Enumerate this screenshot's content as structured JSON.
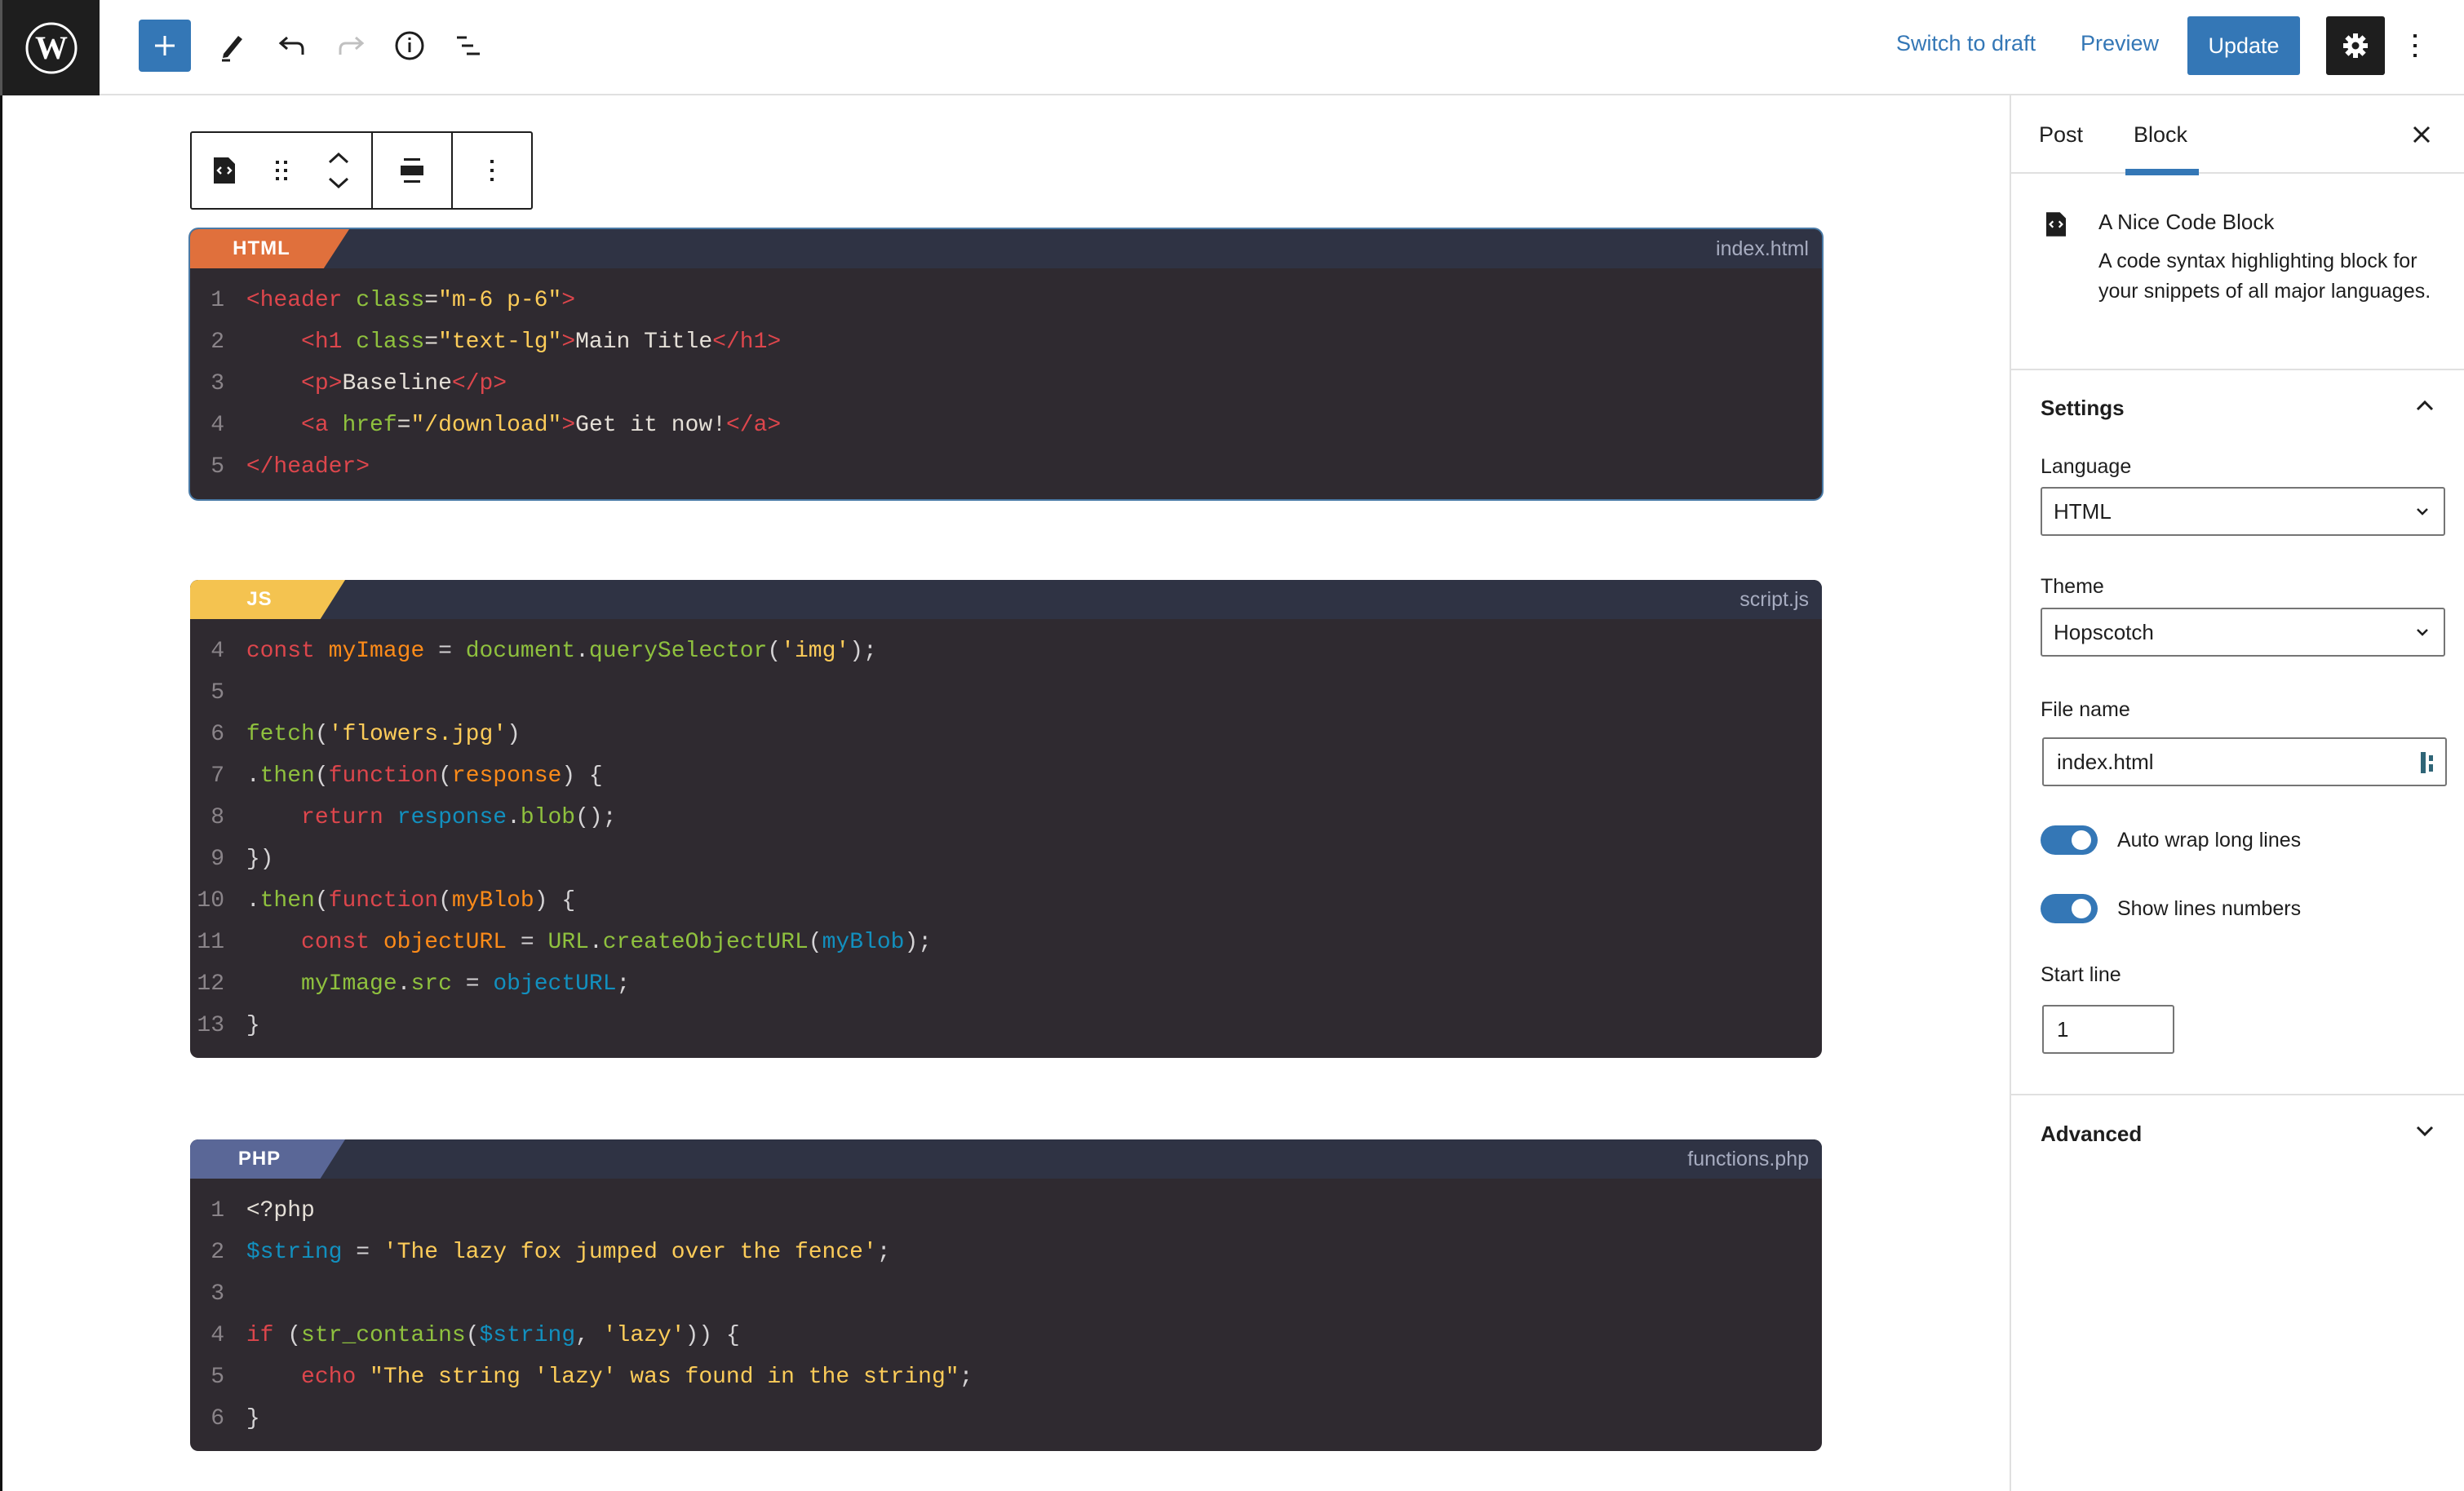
{
  "header": {
    "switch_to_draft": "Switch to draft",
    "preview": "Preview",
    "update": "Update",
    "icons": [
      "wordpress-logo",
      "plus-icon",
      "pencil-icon",
      "undo-icon",
      "redo-icon",
      "info-icon",
      "list-view-icon",
      "gear-icon",
      "more-vertical-icon"
    ]
  },
  "block_toolbar": {
    "icons": [
      "code-file-icon",
      "drag-handle-icon",
      "move-up-icon",
      "move-down-icon",
      "align-icon",
      "more-vertical-icon"
    ]
  },
  "code_blocks": [
    {
      "language": "HTML",
      "filename": "index.html",
      "color": "#e0703c",
      "lines": [
        {
          "n": "1",
          "tokens": [
            [
              "t-tag",
              "<header "
            ],
            [
              "t-attr",
              "class"
            ],
            [
              "t-plain",
              "="
            ],
            [
              "t-str",
              "\"m-6 p-6\""
            ],
            [
              "t-tag",
              ">"
            ]
          ]
        },
        {
          "n": "2",
          "tokens": [
            [
              "t-plain",
              "    "
            ],
            [
              "t-tag",
              "<h1 "
            ],
            [
              "t-attr",
              "class"
            ],
            [
              "t-plain",
              "="
            ],
            [
              "t-str",
              "\"text-lg\""
            ],
            [
              "t-tag",
              ">"
            ],
            [
              "t-plain",
              "Main Title"
            ],
            [
              "t-tag",
              "</h1>"
            ]
          ]
        },
        {
          "n": "3",
          "tokens": [
            [
              "t-plain",
              "    "
            ],
            [
              "t-tag",
              "<p>"
            ],
            [
              "t-plain",
              "Baseline"
            ],
            [
              "t-tag",
              "</p>"
            ]
          ]
        },
        {
          "n": "4",
          "tokens": [
            [
              "t-plain",
              "    "
            ],
            [
              "t-tag",
              "<a "
            ],
            [
              "t-attr",
              "href"
            ],
            [
              "t-plain",
              "="
            ],
            [
              "t-str",
              "\"/download\""
            ],
            [
              "t-tag",
              ">"
            ],
            [
              "t-plain",
              "Get it now!"
            ],
            [
              "t-tag",
              "</a>"
            ]
          ]
        },
        {
          "n": "5",
          "tokens": [
            [
              "t-tag",
              "</header>"
            ]
          ]
        }
      ]
    },
    {
      "language": "JS",
      "filename": "script.js",
      "color": "#f4c350",
      "lines": [
        {
          "n": "4",
          "tokens": [
            [
              "t-kw",
              "const "
            ],
            [
              "t-var",
              "myImage"
            ],
            [
              "t-punc",
              " = "
            ],
            [
              "t-fn",
              "document"
            ],
            [
              "t-punc",
              "."
            ],
            [
              "t-fn",
              "querySelector"
            ],
            [
              "t-punc",
              "("
            ],
            [
              "t-str",
              "'img'"
            ],
            [
              "t-punc",
              ");"
            ]
          ]
        },
        {
          "n": "5",
          "tokens": []
        },
        {
          "n": "6",
          "tokens": [
            [
              "t-fn",
              "fetch"
            ],
            [
              "t-punc",
              "("
            ],
            [
              "t-str",
              "'flowers.jpg'"
            ],
            [
              "t-punc",
              ")"
            ]
          ]
        },
        {
          "n": "7",
          "tokens": [
            [
              "t-punc",
              "."
            ],
            [
              "t-fn",
              "then"
            ],
            [
              "t-punc",
              "("
            ],
            [
              "t-kw",
              "function"
            ],
            [
              "t-punc",
              "("
            ],
            [
              "t-var",
              "response"
            ],
            [
              "t-punc",
              ") {"
            ]
          ]
        },
        {
          "n": "8",
          "tokens": [
            [
              "t-plain",
              "    "
            ],
            [
              "t-kw",
              "return "
            ],
            [
              "t-blue",
              "response"
            ],
            [
              "t-punc",
              "."
            ],
            [
              "t-fn",
              "blob"
            ],
            [
              "t-punc",
              "();"
            ]
          ]
        },
        {
          "n": "9",
          "tokens": [
            [
              "t-punc",
              "})"
            ]
          ]
        },
        {
          "n": "10",
          "tokens": [
            [
              "t-punc",
              "."
            ],
            [
              "t-fn",
              "then"
            ],
            [
              "t-punc",
              "("
            ],
            [
              "t-kw",
              "function"
            ],
            [
              "t-punc",
              "("
            ],
            [
              "t-var",
              "myBlob"
            ],
            [
              "t-punc",
              ") {"
            ]
          ]
        },
        {
          "n": "11",
          "tokens": [
            [
              "t-plain",
              "    "
            ],
            [
              "t-kw",
              "const "
            ],
            [
              "t-var",
              "objectURL"
            ],
            [
              "t-punc",
              " = "
            ],
            [
              "t-fn",
              "URL"
            ],
            [
              "t-punc",
              "."
            ],
            [
              "t-fn",
              "createObjectURL"
            ],
            [
              "t-punc",
              "("
            ],
            [
              "t-blue",
              "myBlob"
            ],
            [
              "t-punc",
              ");"
            ]
          ]
        },
        {
          "n": "12",
          "tokens": [
            [
              "t-plain",
              "    "
            ],
            [
              "t-fn",
              "myImage"
            ],
            [
              "t-punc",
              "."
            ],
            [
              "t-fn",
              "src"
            ],
            [
              "t-punc",
              " = "
            ],
            [
              "t-blue",
              "objectURL"
            ],
            [
              "t-punc",
              ";"
            ]
          ]
        },
        {
          "n": "13",
          "tokens": [
            [
              "t-punc",
              "}"
            ]
          ]
        }
      ]
    },
    {
      "language": "PHP",
      "filename": "functions.php",
      "color": "#5a6797",
      "lines": [
        {
          "n": "1",
          "tokens": [
            [
              "t-plain",
              "<?php"
            ]
          ]
        },
        {
          "n": "2",
          "tokens": [
            [
              "t-blue",
              "$string"
            ],
            [
              "t-punc",
              " = "
            ],
            [
              "t-str",
              "'The lazy fox jumped over the fence'"
            ],
            [
              "t-punc",
              ";"
            ]
          ]
        },
        {
          "n": "3",
          "tokens": []
        },
        {
          "n": "4",
          "tokens": [
            [
              "t-kw",
              "if "
            ],
            [
              "t-punc",
              "("
            ],
            [
              "t-fn",
              "str_contains"
            ],
            [
              "t-punc",
              "("
            ],
            [
              "t-blue",
              "$string"
            ],
            [
              "t-punc",
              ", "
            ],
            [
              "t-str",
              "'lazy'"
            ],
            [
              "t-punc",
              ")) {"
            ]
          ]
        },
        {
          "n": "5",
          "tokens": [
            [
              "t-plain",
              "    "
            ],
            [
              "t-kw",
              "echo "
            ],
            [
              "t-str",
              "\"The string 'lazy' was found in the string\""
            ],
            [
              "t-punc",
              ";"
            ]
          ]
        },
        {
          "n": "6",
          "tokens": [
            [
              "t-punc",
              "}"
            ]
          ]
        }
      ]
    }
  ],
  "sidebar": {
    "tabs": [
      {
        "label": "Post",
        "active": false
      },
      {
        "label": "Block",
        "active": true
      }
    ],
    "block": {
      "title": "A Nice Code Block",
      "description": "A code syntax highlighting block for your snippets of all major languages."
    },
    "settings": {
      "title": "Settings",
      "expanded": true,
      "language_label": "Language",
      "language_value": "HTML",
      "theme_label": "Theme",
      "theme_value": "Hopscotch",
      "filename_label": "File name",
      "filename_value": "index.html",
      "auto_wrap_label": "Auto wrap long lines",
      "auto_wrap_on": true,
      "show_line_numbers_label": "Show lines numbers",
      "show_line_numbers_on": true,
      "start_line_label": "Start line",
      "start_line_value": "1"
    },
    "advanced": {
      "title": "Advanced",
      "expanded": false
    }
  },
  "colors": {
    "accent": "#3477b6",
    "dark": "#1e1e1e",
    "code_bg": "#2f2a30",
    "code_header_bg": "#2f3344"
  }
}
